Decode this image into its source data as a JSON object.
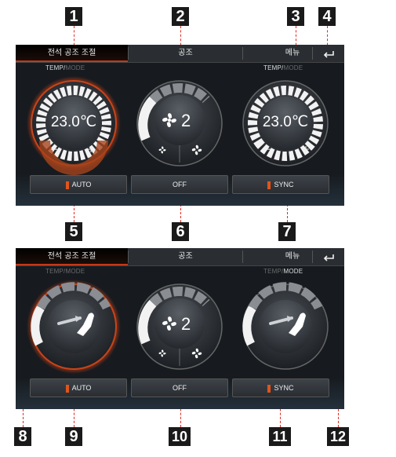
{
  "callouts": [
    "1",
    "2",
    "3",
    "4",
    "5",
    "6",
    "7",
    "8",
    "9",
    "10",
    "11",
    "12"
  ],
  "screen1": {
    "tabs": {
      "dual": "전석 공조 조절",
      "climate": "공조",
      "menu": "메뉴",
      "back_icon": "return-arrow-icon"
    },
    "mode_left": {
      "a": "TEMP/",
      "b": "MODE"
    },
    "mode_right": {
      "a": "TEMP/",
      "b": "MODE"
    },
    "left_temp": "23.0℃",
    "right_temp": "23.0℃",
    "minus": "−",
    "plus": "+",
    "fan_speed": "2",
    "buttons": {
      "auto": "AUTO",
      "off": "OFF",
      "sync": "SYNC"
    }
  },
  "screen2": {
    "tabs": {
      "dual": "전석 공조 조절",
      "climate": "공조",
      "menu": "메뉴",
      "back_icon": "return-arrow-icon"
    },
    "mode_left": {
      "a": "TEMP/",
      "b": "MODE"
    },
    "mode_right": {
      "a": "TEMP/",
      "b": "MODE"
    },
    "fan_speed": "2",
    "buttons": {
      "auto": "AUTO",
      "off": "OFF",
      "sync": "SYNC"
    }
  },
  "colors": {
    "accent": "#e0541b",
    "callout_line": "#e02a20",
    "screen_bg": "#171b20"
  }
}
